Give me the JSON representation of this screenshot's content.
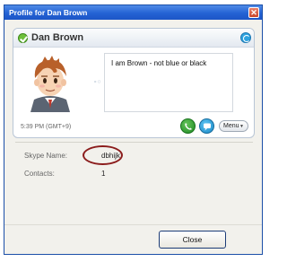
{
  "window": {
    "title": "Profile for Dan Brown",
    "close_glyph": "✕"
  },
  "profile": {
    "name": "Dan Brown",
    "mood": "I am Brown - not blue or black",
    "local_time": "5:39 PM (GMT+9)",
    "status_icon": "online-status-icon",
    "menu_label": "Menu"
  },
  "details": {
    "skype_name_label": "Skype Name:",
    "skype_name_value": "dbhijk",
    "contacts_label": "Contacts:",
    "contacts_value": "1"
  },
  "actions": {
    "close_label": "Close"
  },
  "colors": {
    "titlebar": "#2462d4",
    "online": "#6ec03b",
    "call": "#1e8b24",
    "chat": "#1b8ac7",
    "highlight": "#8b1c1c"
  }
}
